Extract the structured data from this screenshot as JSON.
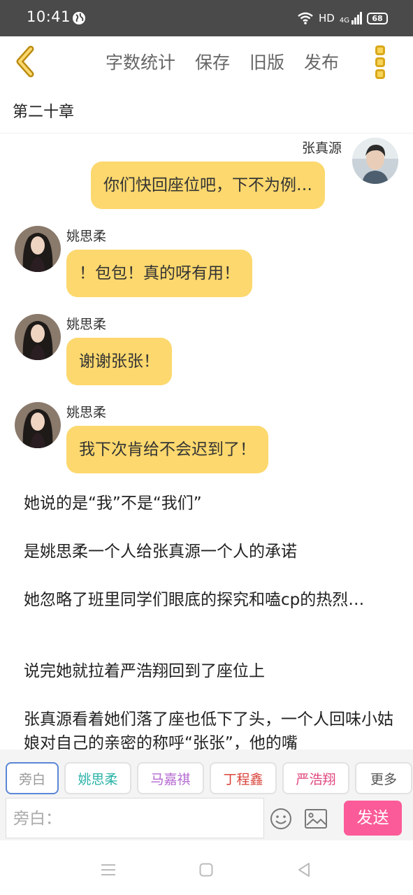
{
  "status_bar": {
    "time": "10:41",
    "network": "HD",
    "signal": "4G",
    "battery": "68"
  },
  "header": {
    "menu": [
      "字数统计",
      "保存",
      "旧版",
      "发布"
    ]
  },
  "chapter_title": "第二十章",
  "messages": [
    {
      "speaker": "张真源",
      "side": "right",
      "text": "你们快回座位吧，下不为例…"
    },
    {
      "speaker": "姚思柔",
      "side": "left",
      "text": "！包包！真的呀有用！"
    },
    {
      "speaker": "姚思柔",
      "side": "left",
      "text": "谢谢张张！"
    },
    {
      "speaker": "姚思柔",
      "side": "left",
      "text": "我下次肯给不会迟到了！"
    }
  ],
  "narration": [
    "她说的是“我”不是“我们”",
    "是姚思柔一个人给张真源一个人的承诺",
    "她忽略了班里同学们眼底的探究和嗑cp的热烈…",
    "说完她就拉着严浩翔回到了座位上",
    "张真源看着她们落了座也低下了头，一个人回味小姑娘对自己的亲密的称呼“张张”，他的嘴"
  ],
  "roles": [
    {
      "label": "旁白",
      "color": "#999999"
    },
    {
      "label": "姚思柔",
      "color": "#2bb3a8"
    },
    {
      "label": "马嘉祺",
      "color": "#b56ad1"
    },
    {
      "label": "丁程鑫",
      "color": "#d9443b"
    },
    {
      "label": "严浩翔",
      "color": "#e0487e"
    },
    {
      "label": "更多",
      "color": "#555555"
    }
  ],
  "input": {
    "placeholder": "旁白："
  },
  "send_label": "发送",
  "colors": {
    "bubble": "#fcd86e",
    "accent": "#fb5b98",
    "back": "#d9a81a"
  }
}
